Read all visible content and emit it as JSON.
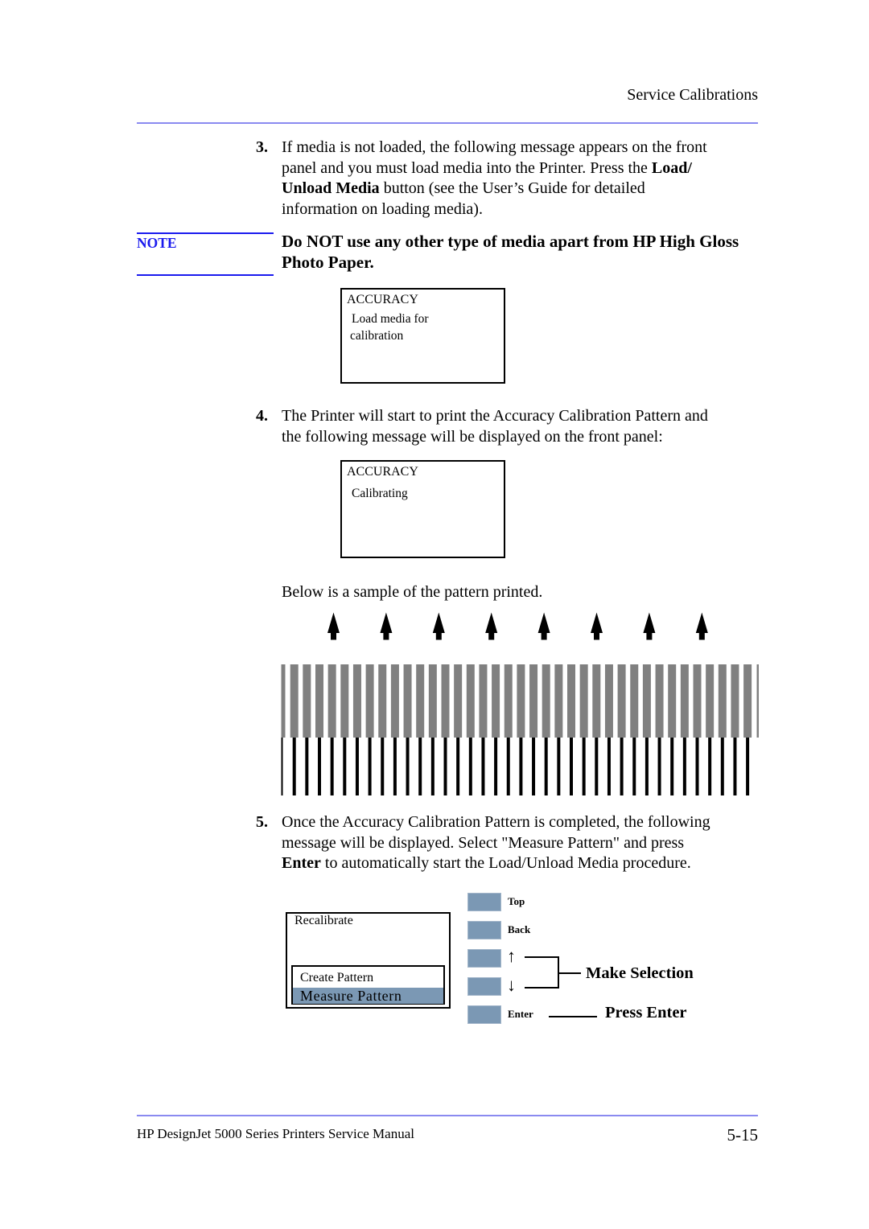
{
  "page": {
    "running_head": "Service Calibrations",
    "footer": {
      "manual_title": "HP DesignJet 5000 Series Printers Service Manual",
      "page_number": "5-15"
    }
  },
  "step3": {
    "number": "3.",
    "lines": [
      [
        "If media is not loaded, the following message appears on the front"
      ],
      [
        "panel and you must load media into the Printer. Press the ",
        "Load/"
      ],
      [
        "Unload Media",
        " button (see the User’s Guide for detailed"
      ],
      [
        "information on loading media)."
      ]
    ]
  },
  "note": {
    "label": "NOTE",
    "lines": [
      "Do NOT use any other type of media apart from HP High Gloss",
      "Photo Paper."
    ]
  },
  "display_load": {
    "title": "ACCURACY",
    "lines": [
      "Load media for",
      "calibration"
    ]
  },
  "step4": {
    "number": "4.",
    "lines": [
      "The Printer will start to print the Accuracy Calibration Pattern and",
      "the following message will be displayed on the front panel:"
    ]
  },
  "display_calibrating": {
    "title": "ACCURACY",
    "lines": [
      "Calibrating"
    ]
  },
  "sample_caption": "Below is a sample of the pattern printed.",
  "pattern": {
    "arrow_count": 8,
    "full_bar_count": 37
  },
  "step5": {
    "number": "5.",
    "lines": [
      [
        "Once the Accuracy Calibration Pattern is completed, the following"
      ],
      [
        "message will be displayed. Select \"Measure Pattern\" and press"
      ],
      [
        "Enter",
        " to automatically start the Load/Unload Media procedure."
      ]
    ]
  },
  "menu_display": {
    "title": "Recalibrate",
    "options": [
      {
        "label": "Create Pattern",
        "selected": false
      },
      {
        "label": "Measure Pattern",
        "selected": true
      }
    ]
  },
  "keypad": {
    "buttons": [
      {
        "label": "Top"
      },
      {
        "label": "Back"
      },
      {
        "label": "↑",
        "icon": "up-arrow"
      },
      {
        "label": "↓",
        "icon": "down-arrow"
      },
      {
        "label": "Enter"
      }
    ],
    "make_selection": "Make Selection",
    "press_enter": "Press Enter"
  },
  "colors": {
    "rule": "#8a8af0",
    "note_blue": "#1a1aee",
    "key_fill": "#7b98b4",
    "pattern_gray": "#808080"
  }
}
